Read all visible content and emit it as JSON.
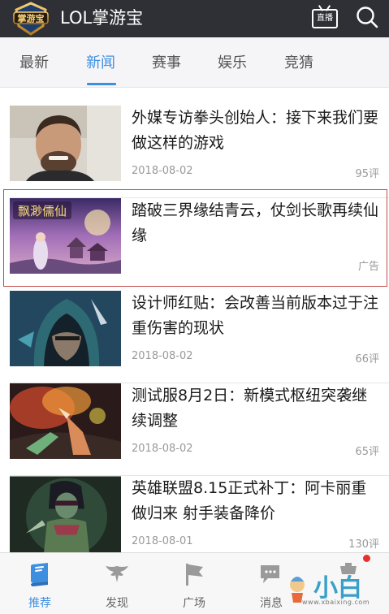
{
  "app": {
    "title": "LOL掌游宝",
    "logo_text": "掌游宝"
  },
  "header": {
    "live_label": "直播",
    "live_icon": "tv-icon",
    "search_icon": "search-icon"
  },
  "tabs": [
    {
      "label": "最新"
    },
    {
      "label": "新闻"
    },
    {
      "label": "赛事"
    },
    {
      "label": "娱乐"
    },
    {
      "label": "竞猜"
    }
  ],
  "active_tab": "新闻",
  "news": [
    {
      "title": "外媒专访拳头创始人：接下来我们要做这样的游戏",
      "date": "2018-08-02",
      "comments": "95评",
      "thumb": "man-portrait"
    },
    {
      "title": "踏破三界缘结青云，仗剑长歌再续仙缘",
      "date": "",
      "comments": "广告",
      "thumb": "fantasy-game-ad",
      "thumb_text": "飘渺儒仙",
      "is_ad": true
    },
    {
      "title": "设计师红贴：会改善当前版本过于注重伤害的现状",
      "date": "2018-08-02",
      "comments": "66评",
      "thumb": "hooded-champion"
    },
    {
      "title": "测试服8月2日：新模式枢纽突袭继续调整",
      "date": "2018-08-02",
      "comments": "65评",
      "thumb": "battle-scene"
    },
    {
      "title": "英雄联盟8.15正式补丁：阿卡丽重做归来 射手装备降价",
      "date": "2018-08-01",
      "comments": "130评",
      "thumb": "akali-art"
    }
  ],
  "bottom_nav": [
    {
      "label": "推荐",
      "icon": "book-icon",
      "active": true
    },
    {
      "label": "发现",
      "icon": "eagle-icon"
    },
    {
      "label": "广场",
      "icon": "flag-icon"
    },
    {
      "label": "消息",
      "icon": "chat-icon"
    },
    {
      "label": "",
      "icon": "profile-icon",
      "badge": true
    }
  ],
  "watermark": {
    "big_text": "小白",
    "url": "www.xbaixing.com"
  },
  "colors": {
    "header_bg": "#2f3035",
    "accent": "#3e8fe0",
    "ad_border": "#c24a4a",
    "badge": "#e5322d"
  }
}
